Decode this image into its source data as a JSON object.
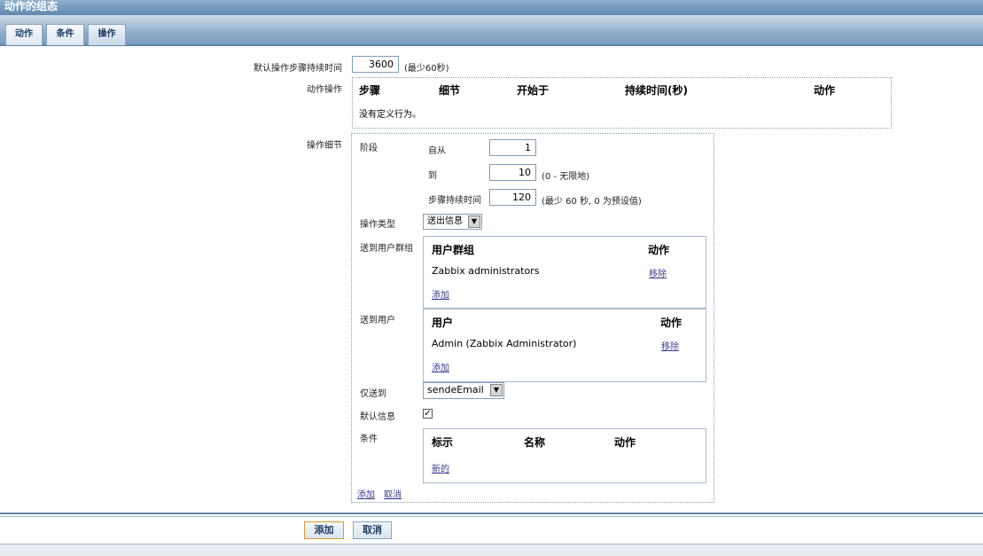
{
  "window": {
    "title": "动作的组态"
  },
  "tabs": [
    {
      "label": "动作"
    },
    {
      "label": "条件"
    },
    {
      "label": "操作"
    }
  ],
  "default_duration": {
    "label": "默认操作步骤持续时间",
    "value": "3600",
    "note": "(最少60秒)"
  },
  "action_ops": {
    "label": "动作操作",
    "headers": [
      "步骤",
      "细节",
      "开始于",
      "持续时间(秒)",
      "动作"
    ],
    "empty_text": "没有定义行为。"
  },
  "op_details": {
    "label": "操作细节",
    "stage": {
      "label": "阶段",
      "from_label": "自从",
      "from_value": "1",
      "to_label": "到",
      "to_value": "10",
      "to_note": "(0 - 无限地)",
      "step_label": "步骤持续时间",
      "step_value": "120",
      "step_note": "(最少 60 秒, 0 为预设值)"
    },
    "op_type": {
      "label": "操作类型",
      "value": "送出信息"
    },
    "send_groups": {
      "label": "送到用户群组",
      "headers": [
        "用户群组",
        "动作"
      ],
      "rows": [
        {
          "name": "Zabbix administrators",
          "action": "移除"
        }
      ],
      "add": "添加"
    },
    "send_users": {
      "label": "送到用户",
      "headers": [
        "用户",
        "动作"
      ],
      "rows": [
        {
          "name": "Admin (Zabbix Administrator)",
          "action": "移除"
        }
      ],
      "add": "添加"
    },
    "send_only": {
      "label": "仅送到",
      "value": "sendeEmail"
    },
    "default_msg": {
      "label": "默认信息",
      "checked": "✓"
    },
    "conditions": {
      "label": "条件",
      "headers": [
        "标示",
        "名称",
        "动作"
      ],
      "new": "新的"
    },
    "add": "添加",
    "cancel": "取消"
  },
  "footer": {
    "add": "添加",
    "cancel": "取消"
  }
}
